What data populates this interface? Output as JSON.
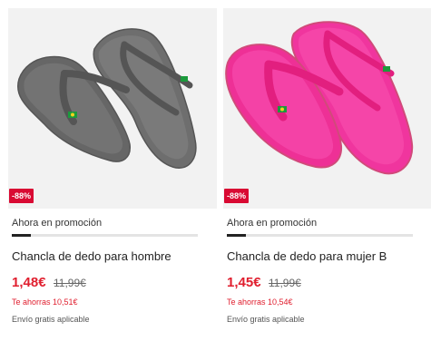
{
  "products": [
    {
      "badge": "-88%",
      "promo_label": "Ahora en promoción",
      "promo_progress": 0.1,
      "title": "Chancla de dedo para hombre",
      "price": "1,48€",
      "old_price": "11,99€",
      "savings": "Te ahorras 10,51€",
      "shipping": "Envío gratis aplicable",
      "color": "#6e6e6e",
      "strap_color": "#5a5a5a"
    },
    {
      "badge": "-88%",
      "promo_label": "Ahora en promoción",
      "promo_progress": 0.1,
      "title": "Chancla de dedo para mujer B",
      "price": "1,45€",
      "old_price": "11,99€",
      "savings": "Te ahorras 10,54€",
      "shipping": "Envío gratis aplicable",
      "color": "#f0359e",
      "strap_color": "#e21f7f"
    }
  ],
  "colors": {
    "accent": "#e01e2e",
    "badge": "#d90a33",
    "progress_fill": "#222222",
    "progress_track": "#e4e4e4"
  }
}
